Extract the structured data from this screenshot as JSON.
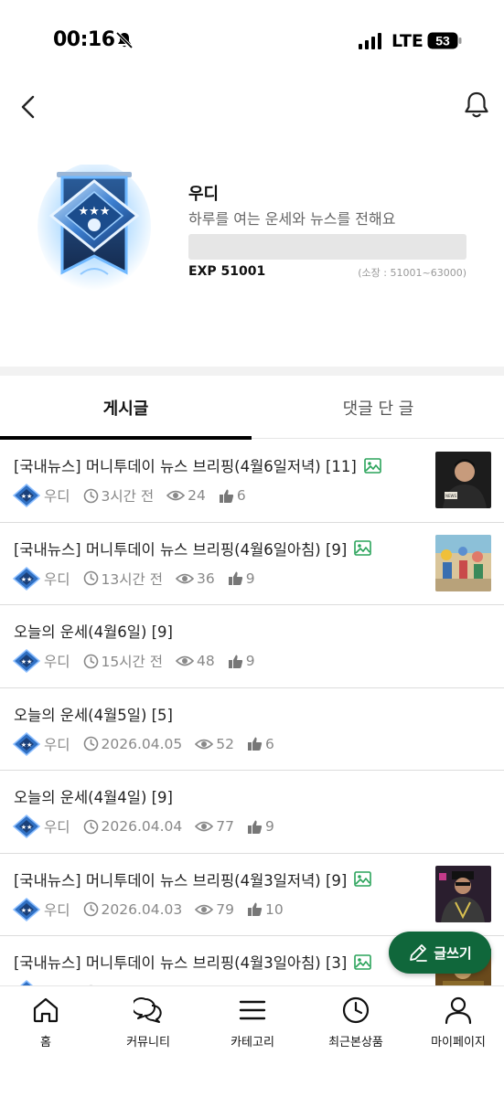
{
  "status_bar": {
    "time": "00:16",
    "network": "LTE",
    "battery": "53"
  },
  "profile": {
    "name": "우디",
    "description": "하루를 여는 운세와 뉴스를 전해요",
    "exp_label": "EXP 51001",
    "exp_range": "(소장 : 51001~63000)",
    "exp_progress": 0
  },
  "tabs": [
    {
      "label": "게시글",
      "active": true
    },
    {
      "label": "댓글 단 글",
      "active": false
    }
  ],
  "posts": [
    {
      "title": "[국내뉴스] 머니투데이 뉴스 브리핑(4월6일저녁) [11]",
      "has_image": true,
      "author": "우디",
      "time": "3시간 전",
      "views": "24",
      "likes": "6",
      "thumb": "thumb-news-evening"
    },
    {
      "title": "[국내뉴스] 머니투데이 뉴스 브리핑(4월6일아침) [9]",
      "has_image": true,
      "author": "우디",
      "time": "13시간 전",
      "views": "36",
      "likes": "9",
      "thumb": "thumb-news-morning"
    },
    {
      "title": "오늘의 운세(4월6일) [9]",
      "has_image": false,
      "author": "우디",
      "time": "15시간 전",
      "views": "48",
      "likes": "9"
    },
    {
      "title": "오늘의 운세(4월5일) [5]",
      "has_image": false,
      "author": "우디",
      "time": "2026.04.05",
      "views": "52",
      "likes": "6"
    },
    {
      "title": "오늘의 운세(4월4일) [9]",
      "has_image": false,
      "author": "우디",
      "time": "2026.04.04",
      "views": "77",
      "likes": "9"
    },
    {
      "title": "[국내뉴스] 머니투데이 뉴스 브리핑(4월3일저녁) [9]",
      "has_image": true,
      "author": "우디",
      "time": "2026.04.03",
      "views": "79",
      "likes": "10",
      "thumb": "thumb-news-evening-2"
    },
    {
      "title": "[국내뉴스] 머니투데이 뉴스 브리핑(4월3일아침) [3]",
      "has_image": true,
      "author": "우디",
      "time": "",
      "views": "",
      "likes": "",
      "thumb": "thumb-news-morning-2"
    }
  ],
  "write_button": {
    "label": "글쓰기"
  },
  "bottom_nav": [
    {
      "label": "홈",
      "icon": "home-icon"
    },
    {
      "label": "커뮤니티",
      "icon": "chat-bubbles-icon"
    },
    {
      "label": "카테고리",
      "icon": "menu-icon"
    },
    {
      "label": "최근본상품",
      "icon": "clock-icon"
    },
    {
      "label": "마이페이지",
      "icon": "person-icon"
    }
  ],
  "colors": {
    "accent": "#10673b",
    "text": "#222222",
    "muted": "#888888"
  }
}
